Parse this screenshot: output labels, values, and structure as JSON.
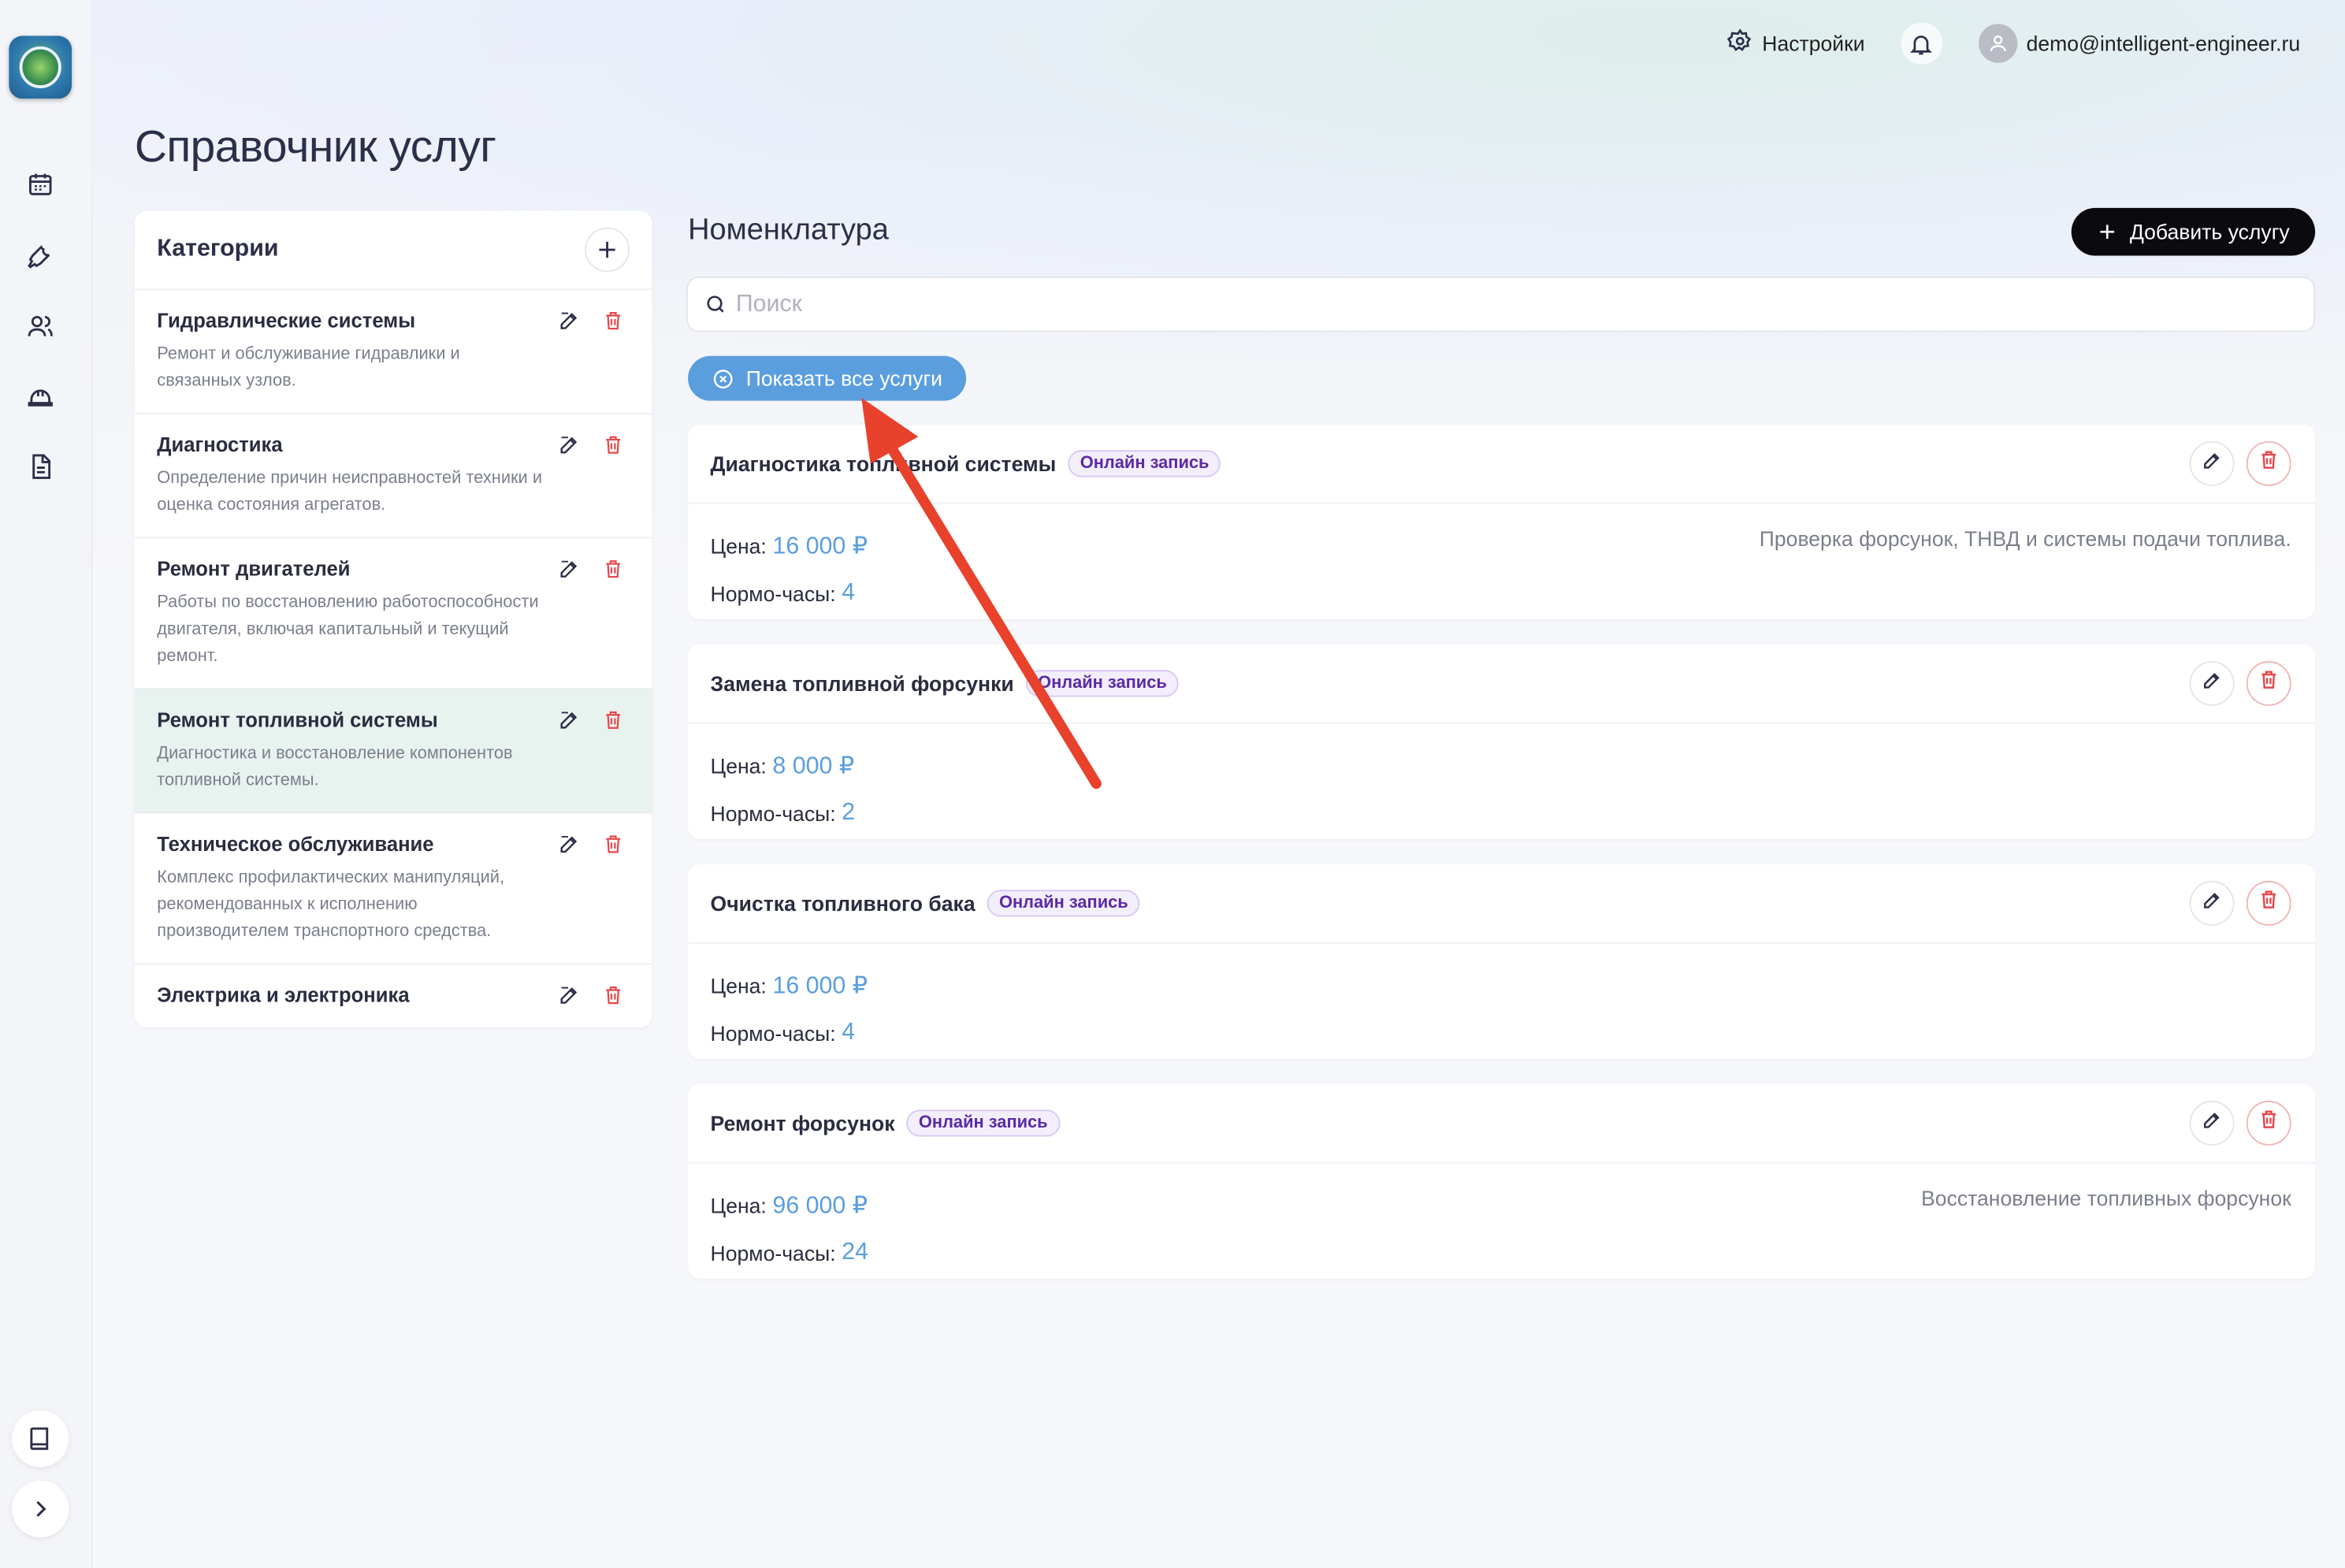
{
  "user": {
    "email": "demo@intelligent-engineer.ru"
  },
  "topbar": {
    "settings_label": "Настройки"
  },
  "page_title": "Справочник услуг",
  "categories": {
    "title": "Категории",
    "items": [
      {
        "name": "Гидравлические системы",
        "desc": "Ремонт и обслуживание гидравлики и связанных узлов."
      },
      {
        "name": "Диагностика",
        "desc": "Определение причин неисправностей техники и оценка состояния агрегатов."
      },
      {
        "name": "Ремонт двигателей",
        "desc": "Работы по восстановлению работоспособности двигателя, включая капитальный и текущий ремонт."
      },
      {
        "name": "Ремонт топливной системы",
        "desc": "Диагностика и восстановление компонентов топливной системы.",
        "active": true
      },
      {
        "name": "Техническое обслуживание",
        "desc": "Комплекс профилактических манипуляций, рекомендованных к исполнению производителем транспортного средства."
      },
      {
        "name": "Электрика и электроника",
        "desc": ""
      }
    ]
  },
  "nomenclature": {
    "title": "Номенклатура",
    "add_label": "Добавить услугу",
    "search_placeholder": "Поиск",
    "show_all_label": "Показать все услуги",
    "price_label": "Цена:",
    "hours_label": "Нормо-часы:",
    "badge_label": "Онлайн запись",
    "services": [
      {
        "name": "Диагностика топливной системы",
        "price": "16 000 ₽",
        "hours": "4",
        "desc": "Проверка форсунок, ТНВД и системы подачи топлива."
      },
      {
        "name": "Замена топливной форсунки",
        "price": "8 000 ₽",
        "hours": "2",
        "desc": ""
      },
      {
        "name": "Очистка топливного бака",
        "price": "16 000 ₽",
        "hours": "4",
        "desc": ""
      },
      {
        "name": "Ремонт форсунок",
        "price": "96 000 ₽",
        "hours": "24",
        "desc": "Восстановление топливных форсунок"
      }
    ]
  },
  "colors": {
    "accent": "#5b9ede",
    "danger": "#e5484d",
    "annotation_arrow": "#e8412c"
  }
}
